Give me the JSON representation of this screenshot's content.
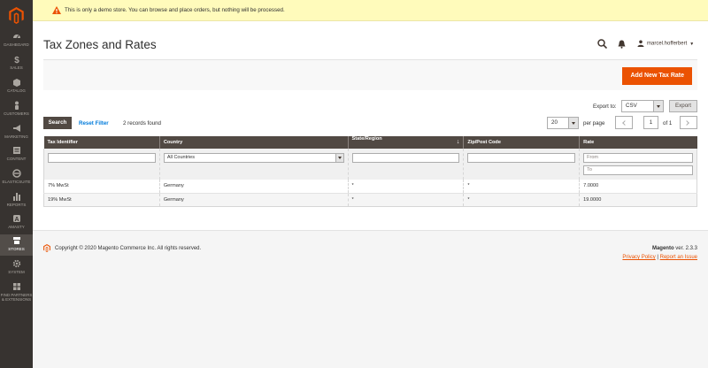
{
  "sidebar": {
    "items": [
      {
        "label": "DASHBOARD",
        "icon": "dashboard-icon"
      },
      {
        "label": "SALES",
        "icon": "dollar-icon"
      },
      {
        "label": "CATALOG",
        "icon": "box-icon"
      },
      {
        "label": "CUSTOMERS",
        "icon": "person-icon"
      },
      {
        "label": "MARKETING",
        "icon": "megaphone-icon"
      },
      {
        "label": "CONTENT",
        "icon": "content-icon"
      },
      {
        "label": "ELASTICSUITE",
        "icon": "elasticsuite-icon"
      },
      {
        "label": "REPORTS",
        "icon": "bar-chart-icon"
      },
      {
        "label": "AMASTY",
        "icon": "amasty-icon"
      },
      {
        "label": "STORES",
        "icon": "store-icon"
      },
      {
        "label": "SYSTEM",
        "icon": "gear-icon"
      },
      {
        "label": "FIND PARTNERS & EXTENSIONS",
        "icon": "partners-icon"
      }
    ]
  },
  "notice": {
    "text": "This is only a demo store. You can browse and place orders, but nothing will be processed."
  },
  "header": {
    "title": "Tax Zones and Rates",
    "user": "marcel.hofferbert"
  },
  "actions": {
    "add_new": "Add New Tax Rate"
  },
  "toolbar": {
    "export_label": "Export to:",
    "export_format": "CSV",
    "export_button": "Export",
    "search_button": "Search",
    "reset_filter": "Reset Filter",
    "records_found": "2 records found",
    "page_size": "20",
    "per_page": "per page",
    "current_page": "1",
    "of_pages": "of 1"
  },
  "grid": {
    "columns": [
      "Tax Identifier",
      "Country",
      "State/Region",
      "Zip/Post Code",
      "Rate"
    ],
    "filters": {
      "country": "All Countries",
      "rate_from": "From",
      "rate_to": "To"
    },
    "rows": [
      {
        "identifier": "7% MwSt",
        "country": "Germany",
        "region": "*",
        "zip": "*",
        "rate": "7.0000"
      },
      {
        "identifier": "19% MwSt",
        "country": "Germany",
        "region": "*",
        "zip": "*",
        "rate": "19.0000"
      }
    ]
  },
  "footer": {
    "copyright": "Copyright © 2020 Magento Commerce Inc. All rights reserved.",
    "brand": "Magento",
    "version": " ver. 2.3.3",
    "privacy": "Privacy Policy",
    "separator": " | ",
    "report": "Report an Issue"
  },
  "colors": {
    "accent": "#eb5202",
    "sidebar": "#373330",
    "grid_header": "#514943",
    "link": "#007bdb",
    "notice_bg": "#fffbbb"
  }
}
